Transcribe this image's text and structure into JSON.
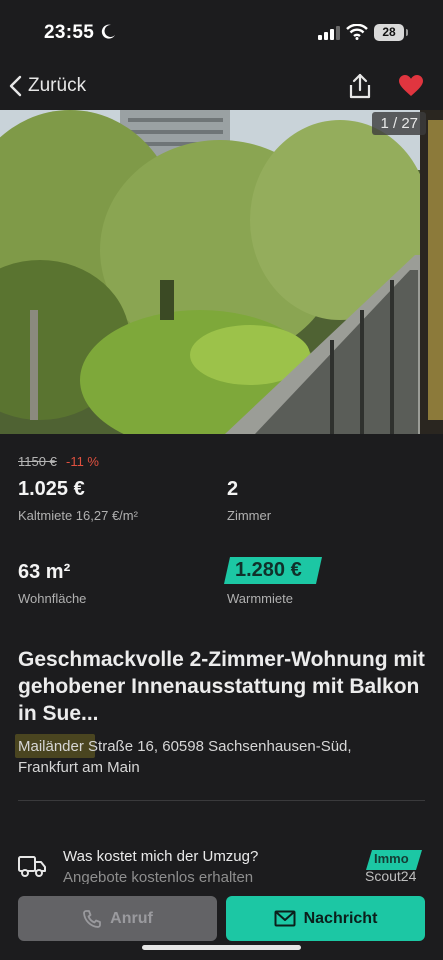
{
  "status_bar": {
    "time": "23:55",
    "battery": "28"
  },
  "nav": {
    "back_label": "Zurück"
  },
  "photo": {
    "counter": "1 / 27"
  },
  "price": {
    "old": "1150 €",
    "discount": "-11 %",
    "kaltmiete_value": "1.025 €",
    "kaltmiete_label": "Kaltmiete 16,27 €/m²",
    "rooms_value": "2",
    "rooms_label": "Zimmer",
    "area_value": "63 m²",
    "area_label": "Wohnfläche",
    "warm_value": "1.280 €",
    "warm_label": "Warmmiete"
  },
  "listing": {
    "title": "Geschmackvolle 2-Zimmer-Wohnung mit gehobener Innenausstattung mit Balkon in Sue...",
    "address_line1": "Mailänder Straße 16, 60598 Sachsenhausen-Süd,",
    "address_line2": "Frankfurt am Main"
  },
  "moving": {
    "question": "Was kostet mich der Umzug?",
    "subtitle": "Angebote kostenlos erhalten",
    "logo_top": "Immo",
    "logo_bottom": "Scout24"
  },
  "actions": {
    "call_label": "Anruf",
    "message_label": "Nachricht"
  },
  "colors": {
    "accent": "#1cc7a4",
    "heart": "#e0353f",
    "discount": "#e0503f"
  }
}
